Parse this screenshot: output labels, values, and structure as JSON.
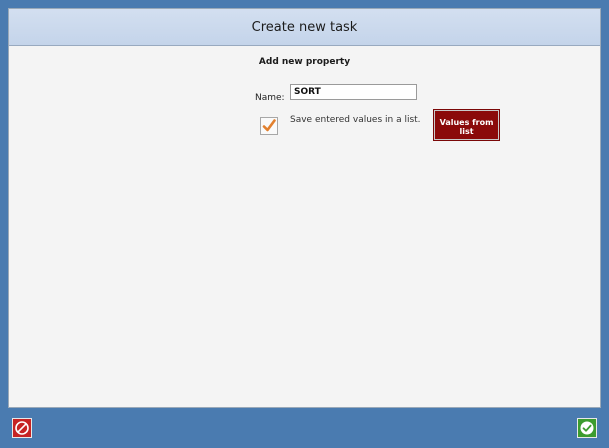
{
  "dialog": {
    "title": "Create new task",
    "subtitle": "Add new property"
  },
  "form": {
    "name_label": "Name:",
    "name_value": "SORT",
    "save_checked": true,
    "save_label": "Save entered values in a list.",
    "values_button_label": "Values from list"
  },
  "footer": {
    "cancel_icon": "prohibited-icon",
    "ok_icon": "checkmark-icon"
  },
  "colors": {
    "accent": "#4a7bb0",
    "titlebar": "#c4d4ea",
    "values_button": "#8b0a0a",
    "check_mark": "#e2802e",
    "cancel": "#c62323",
    "ok": "#3c9c2f"
  }
}
